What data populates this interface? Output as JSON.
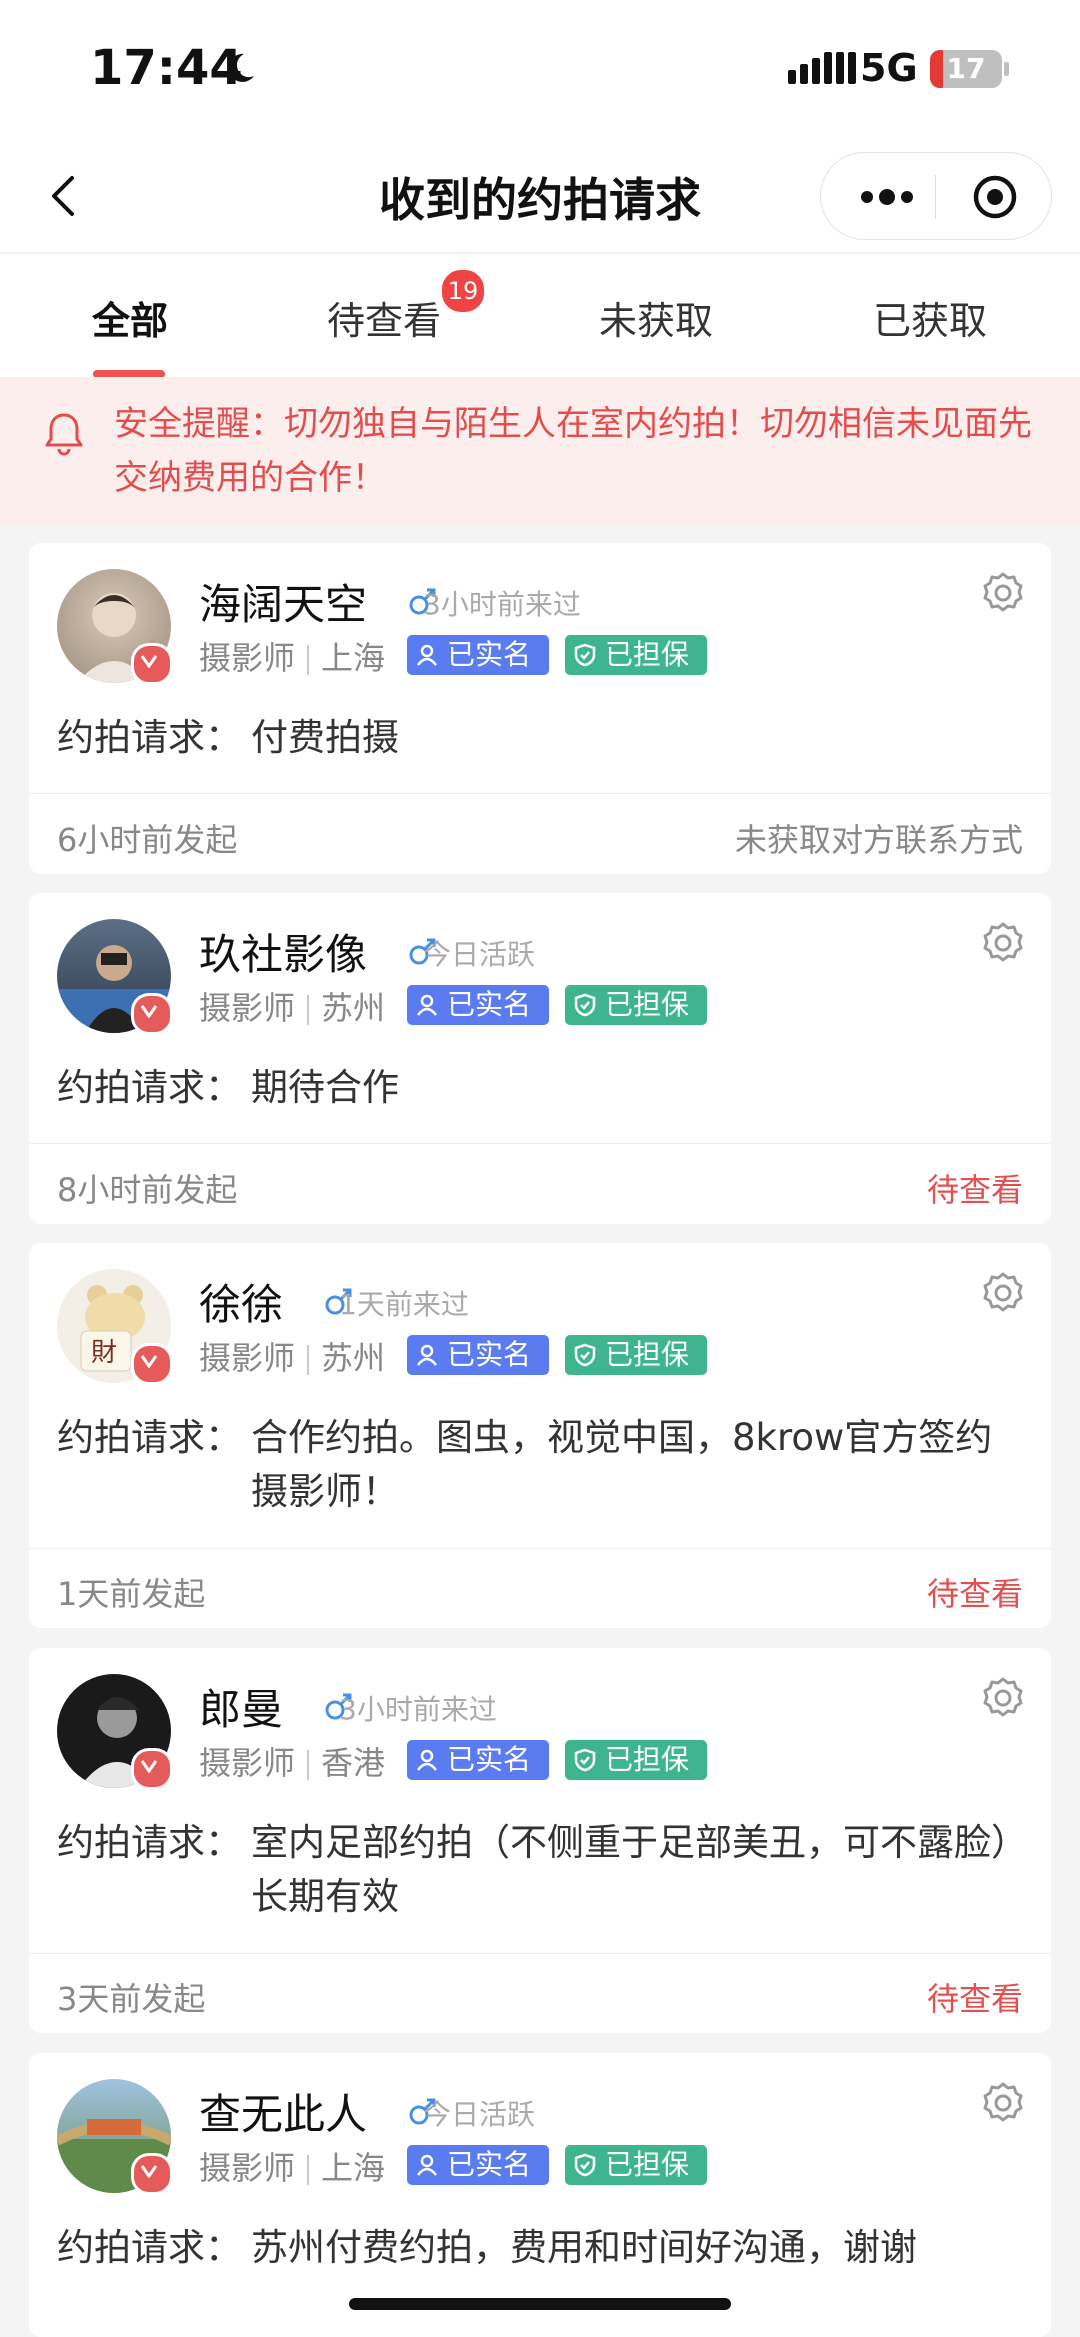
{
  "status_bar": {
    "time": "17:44",
    "network": "5G",
    "battery": "17"
  },
  "header": {
    "title": "收到的约拍请求"
  },
  "tabs": [
    {
      "label": "全部",
      "active": true
    },
    {
      "label": "待查看",
      "badge": "19"
    },
    {
      "label": "未获取"
    },
    {
      "label": "已获取"
    }
  ],
  "notice": {
    "text": "安全提醒：切勿独自与陌生人在室内约拍！切勿相信未见面先交纳费用的合作！"
  },
  "request_label": "约拍请求：",
  "cards": [
    {
      "name": "海阔天空",
      "active": "3小时前来过",
      "role": "摄影师",
      "city": "上海",
      "tag_realname": "已实名",
      "tag_guarantee": "已担保",
      "request": "付费拍摄",
      "time": "6小时前发起",
      "status": "未获取对方联系方式"
    },
    {
      "name": "玖社影像",
      "active": "今日活跃",
      "role": "摄影师",
      "city": "苏州",
      "tag_realname": "已实名",
      "tag_guarantee": "已担保",
      "request": "期待合作",
      "time": "8小时前发起",
      "status": "待查看"
    },
    {
      "name": "徐徐",
      "active": "1天前来过",
      "role": "摄影师",
      "city": "苏州",
      "tag_realname": "已实名",
      "tag_guarantee": "已担保",
      "avatar_text": "財",
      "request": "合作约拍。图虫，视觉中国，8krow官方签约摄影师！",
      "time": "1天前发起",
      "status": "待查看"
    },
    {
      "name": "郎曼",
      "active": "3小时前来过",
      "role": "摄影师",
      "city": "香港",
      "tag_realname": "已实名",
      "tag_guarantee": "已担保",
      "request": "室内足部约拍（不侧重于足部美丑，可不露脸）长期有效",
      "time": "3天前发起",
      "status": "待查看"
    },
    {
      "name": "查无此人",
      "active": "今日活跃",
      "role": "摄影师",
      "city": "上海",
      "tag_realname": "已实名",
      "tag_guarantee": "已担保",
      "request": "苏州付费约拍，费用和时间好沟通，谢谢",
      "time": "",
      "status": ""
    }
  ],
  "colors": {
    "accent": "#ef5350",
    "realname": "#5b7cf0",
    "guarantee": "#3fb58f",
    "notice_text": "#e24e4e"
  }
}
